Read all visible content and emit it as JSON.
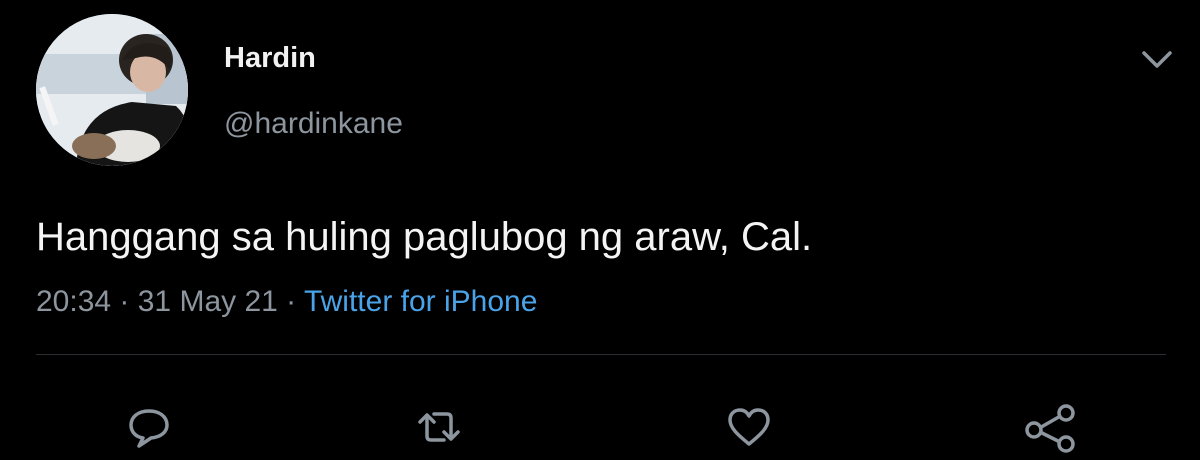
{
  "tweet": {
    "author": {
      "display_name": "Hardin",
      "handle": "@hardinkane",
      "avatar_icon": "profile-photo"
    },
    "text": "Hanggang sa huling paglubog ng araw, Cal.",
    "meta": {
      "time": "20:34",
      "separator": " · ",
      "date": "31 May 21",
      "source": "Twitter for iPhone"
    },
    "actions": [
      {
        "name": "reply",
        "icon": "speech-bubble-icon"
      },
      {
        "name": "retweet",
        "icon": "retweet-arrows-icon"
      },
      {
        "name": "like",
        "icon": "heart-icon"
      },
      {
        "name": "share",
        "icon": "share-nodes-icon"
      }
    ],
    "colors": {
      "background": "#000000",
      "text": "#f4f4f4",
      "secondary": "#8d959e",
      "link": "#4aa3e8"
    }
  }
}
